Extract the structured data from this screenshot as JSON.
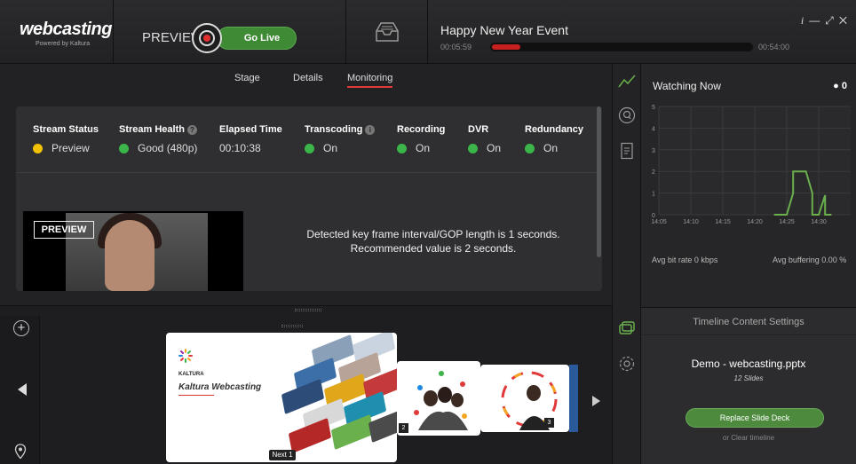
{
  "header": {
    "logo_title": "webcasting",
    "logo_subtitle": "Powered by Kaltura",
    "preview_label": "PREVIEW",
    "go_live_label": "Go Live",
    "event_title": "Happy New Year Event",
    "elapsed": "00:05:59",
    "total": "00:54:00",
    "progress_fraction": 0.11,
    "window_controls": [
      "info-icon",
      "minimize-icon",
      "expand-icon",
      "close-icon"
    ],
    "info_label": "i"
  },
  "tabs": [
    {
      "label": "Stage",
      "active": false
    },
    {
      "label": "Details",
      "active": false
    },
    {
      "label": "Monitoring",
      "active": true
    }
  ],
  "status": [
    {
      "header": "Stream Status",
      "value": "Preview",
      "color": "#f2c200"
    },
    {
      "header": "Stream Health",
      "value": "Good (480p)",
      "color": "#3bb54a",
      "has_info": true
    },
    {
      "header": "Elapsed Time",
      "value": "00:10:38",
      "color": null
    },
    {
      "header": "Transcoding",
      "value": "On",
      "color": "#3bb54a",
      "has_info": true
    },
    {
      "header": "Recording",
      "value": "On",
      "color": "#3bb54a"
    },
    {
      "header": "DVR",
      "value": "On",
      "color": "#3bb54a"
    },
    {
      "header": "Redundancy",
      "value": "On",
      "color": "#3bb54a"
    }
  ],
  "video": {
    "preview_tag": "PREVIEW"
  },
  "gop_message": {
    "line1": "Detected key frame interval/GOP length is 1 seconds.",
    "line2": "Recommended value is 2 seconds."
  },
  "watching": {
    "title": "Watching Now",
    "count": "0",
    "avg_bitrate": "Avg bit rate 0 kbps",
    "avg_buffering": "Avg buffering 0.00 %"
  },
  "chart_data": {
    "type": "line",
    "title": "",
    "x_ticks": [
      "14:05",
      "14:10",
      "14:15",
      "14:20",
      "14:25",
      "14:30"
    ],
    "y_ticks": [
      "0",
      "1",
      "2",
      "3",
      "4",
      "5"
    ],
    "ylim": [
      0,
      5
    ],
    "grid": true,
    "color": "#6ab04c",
    "series": [
      {
        "x": [
          "14:23",
          "14:25",
          "14:26",
          "14:26",
          "14:28",
          "14:29",
          "14:29",
          "14:30",
          "14:31",
          "14:31",
          "14:32"
        ],
        "values": [
          0,
          0,
          1,
          2,
          2,
          1,
          0,
          0,
          0.9,
          0,
          0
        ]
      }
    ]
  },
  "timeline_settings": {
    "title": "Timeline Content Settings",
    "deck_name": "Demo - webcasting.pptx",
    "slide_count": "12 Slides",
    "replace_label": "Replace Slide Deck",
    "clear_label": "or Clear timeline"
  },
  "slides": {
    "slide1_brand": "KALTURA",
    "slide1_title": "Kaltura Webcasting",
    "next_label": "Next 1",
    "slide2_number": "2",
    "slide3_number": "3"
  },
  "icons": {
    "sidebar": [
      "analytics-icon",
      "q-and-a-icon",
      "notes-icon",
      "slides-icon",
      "settings-icon"
    ],
    "add": "+",
    "location": "location-pin-icon"
  }
}
